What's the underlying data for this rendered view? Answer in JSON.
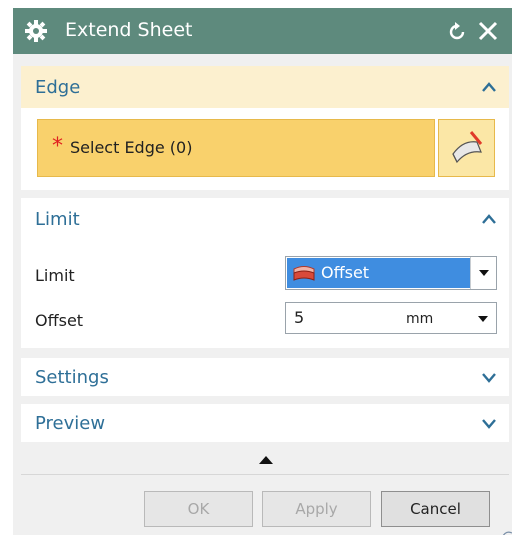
{
  "dialog": {
    "title": "Extend Sheet",
    "icons": {
      "title_icon": "gear-icon",
      "reset": "reset-icon",
      "close": "close-icon"
    }
  },
  "edge_section": {
    "title": "Edge",
    "select_label": "Select Edge (0)",
    "required_marker": "*",
    "button_icon": "select-edge-icon"
  },
  "limit_section": {
    "title": "Limit",
    "limit_label": "Limit",
    "limit_value": "Offset",
    "offset_label": "Offset",
    "offset_value": "5",
    "offset_unit": "mm"
  },
  "settings_section": {
    "title": "Settings"
  },
  "preview_section": {
    "title": "Preview"
  },
  "buttons": {
    "ok": "OK",
    "apply": "Apply",
    "cancel": "Cancel"
  },
  "colors": {
    "titlebar": "#5e8a7d",
    "section_title": "#2e6f97",
    "selection_row": "#f9d16c",
    "combo_selected": "#3f8de0"
  }
}
